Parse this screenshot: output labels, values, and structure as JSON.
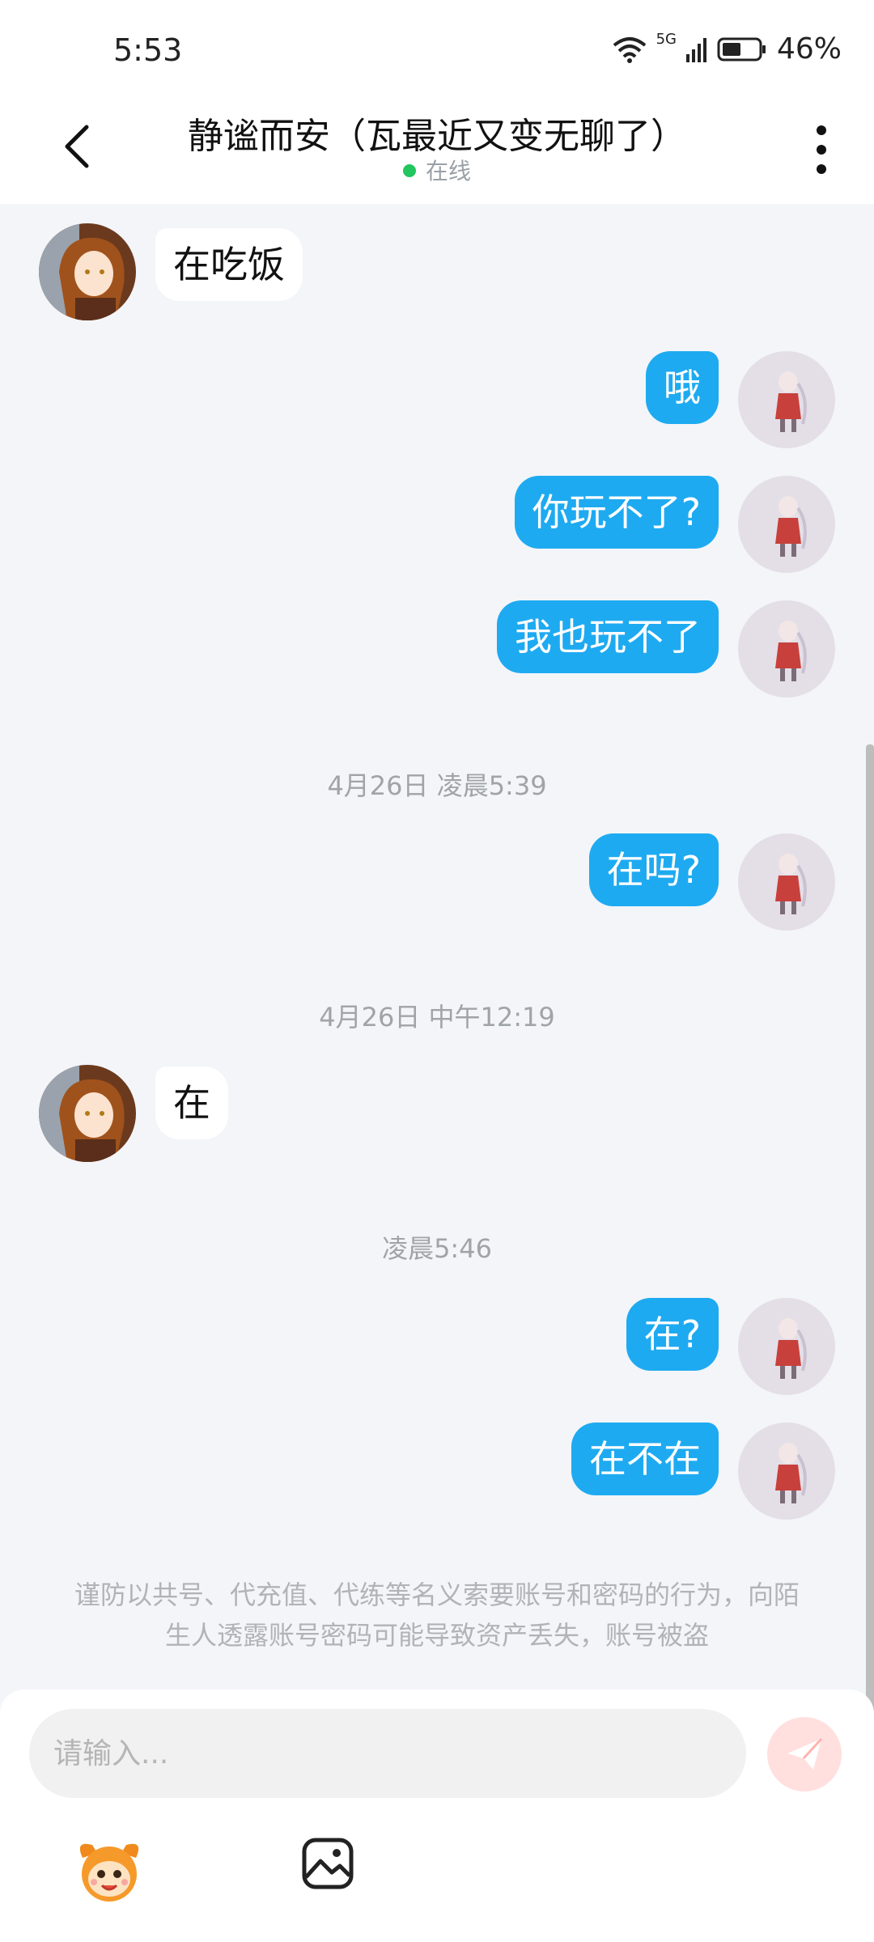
{
  "status_bar": {
    "time": "5:53",
    "network": "5G",
    "battery": "46%"
  },
  "header": {
    "title": "静谧而安（瓦最近又变无聊了）",
    "status": "在线",
    "icons": {
      "back": "back-chevron-icon",
      "more": "more-vertical-icon"
    }
  },
  "messages": [
    {
      "type": "incoming",
      "text": "在吃饭"
    },
    {
      "type": "outgoing",
      "text": "哦"
    },
    {
      "type": "outgoing",
      "text": "你玩不了?"
    },
    {
      "type": "outgoing",
      "text": "我也玩不了"
    },
    {
      "type": "timestamp",
      "text": "4月26日 凌晨5:39"
    },
    {
      "type": "outgoing",
      "text": "在吗?"
    },
    {
      "type": "timestamp",
      "text": "4月26日 中午12:19"
    },
    {
      "type": "incoming",
      "text": "在"
    },
    {
      "type": "timestamp",
      "text": "凌晨5:46"
    },
    {
      "type": "outgoing",
      "text": "在?"
    },
    {
      "type": "outgoing",
      "text": "在不在"
    }
  ],
  "notice": "谨防以共号、代充值、代练等名义索要账号和密码的行为，向陌生人透露账号密码可能导致资产丢失，账号被盗",
  "composer": {
    "placeholder": "请输入...",
    "icons": {
      "send": "send-icon",
      "emoji": "emoji-mascot-icon",
      "image": "image-icon"
    }
  },
  "colors": {
    "outgoing_bubble": "#1eaaf1",
    "incoming_bubble": "#ffffff",
    "background": "#f3f5f8",
    "online": "#22c55e",
    "send_button": "#ffe0de"
  }
}
